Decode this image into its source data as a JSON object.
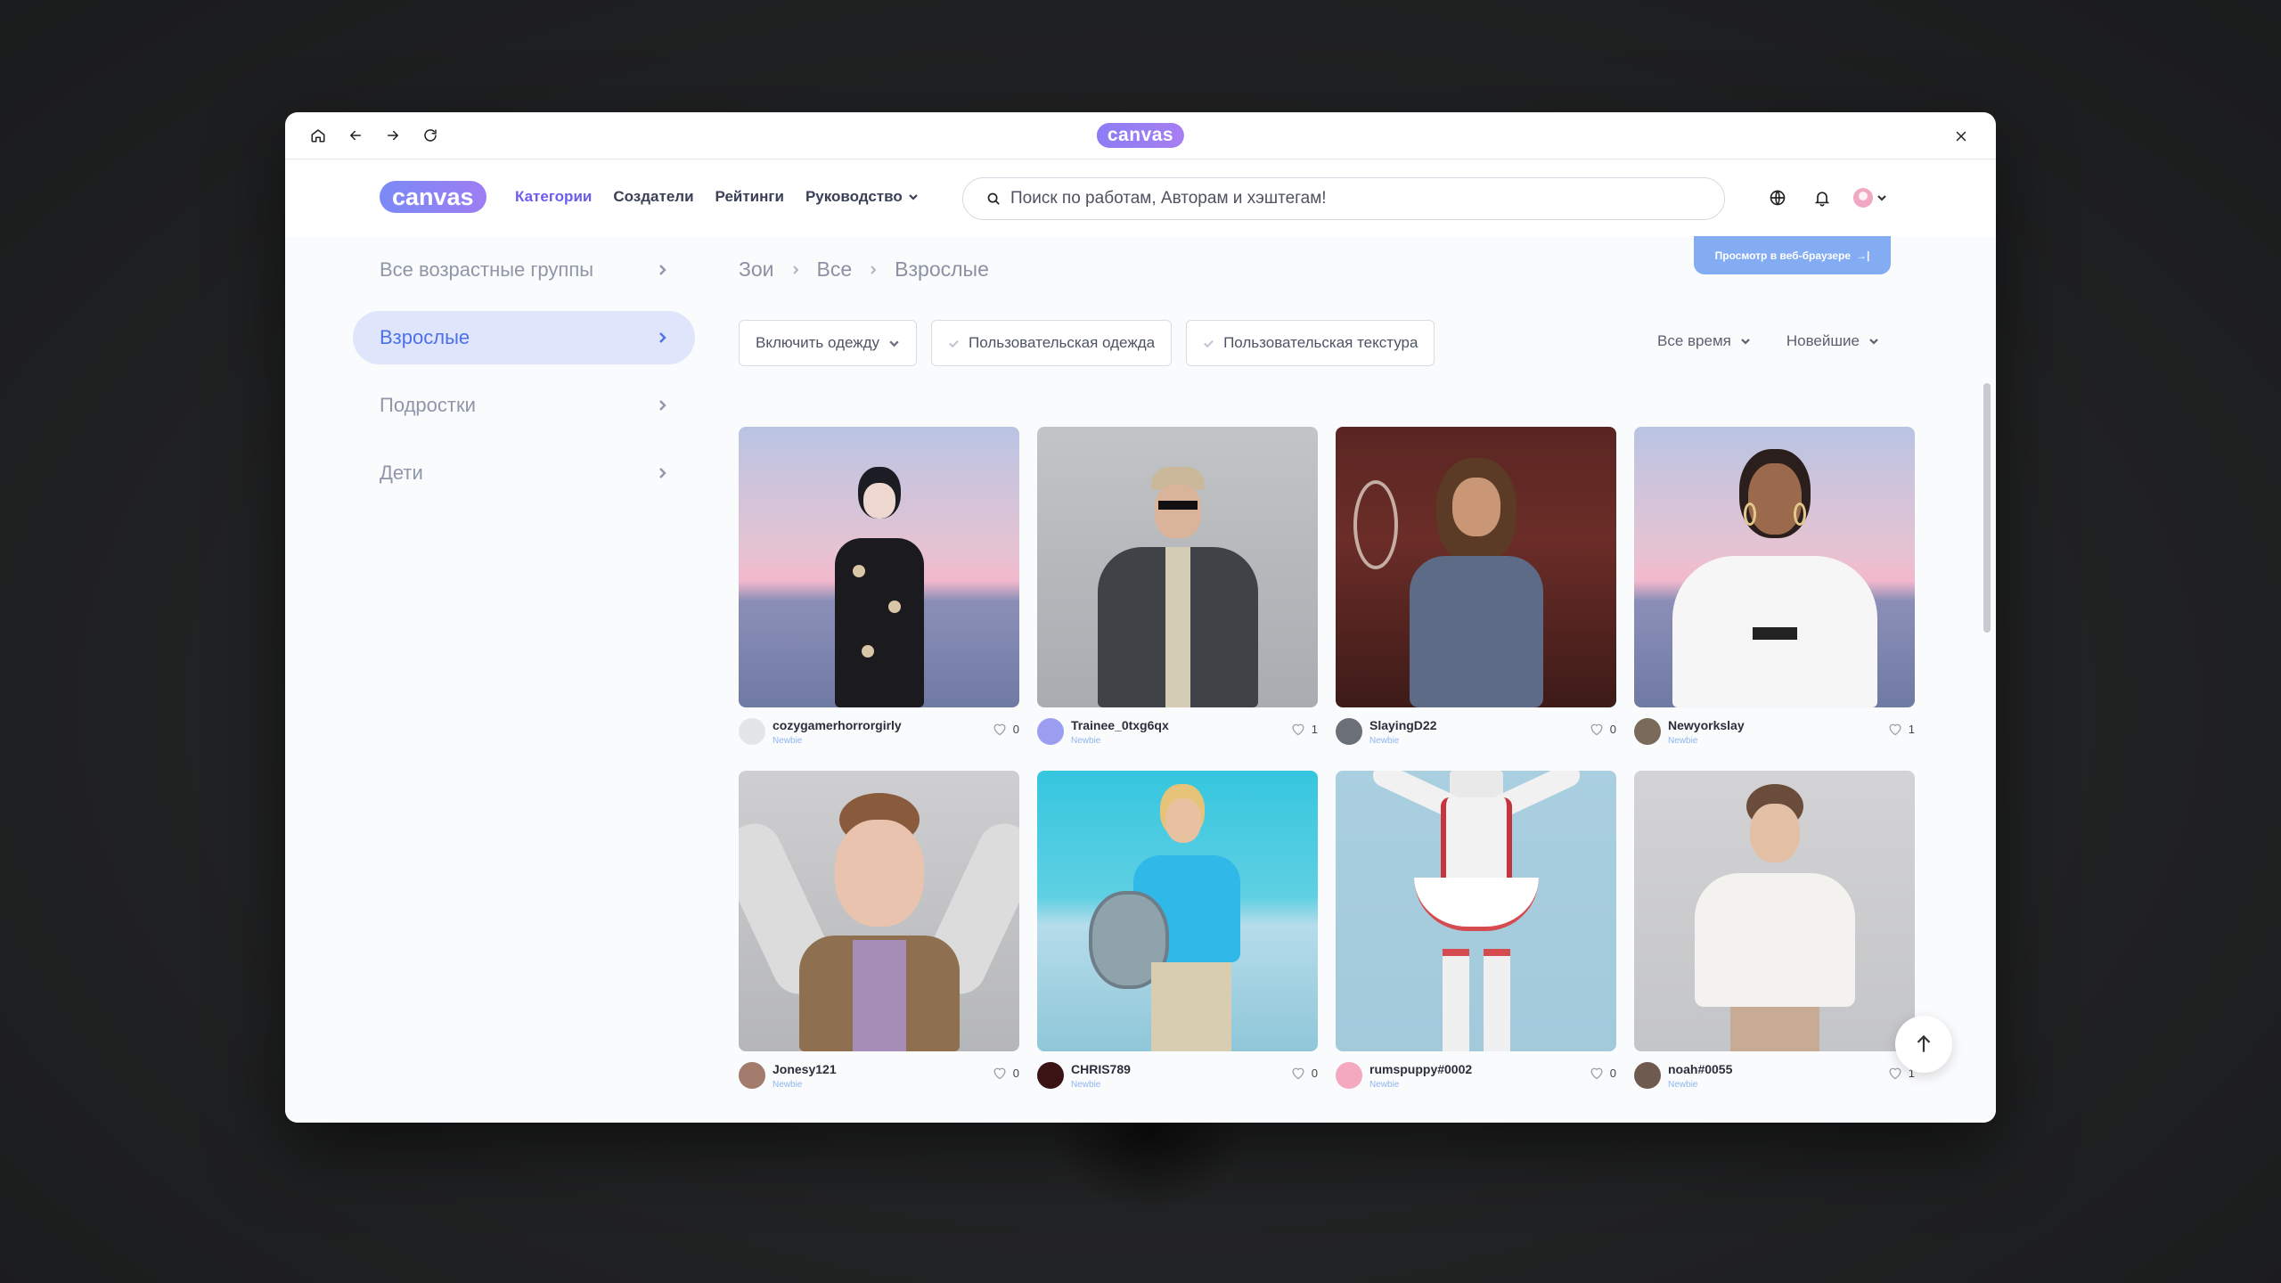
{
  "browser": {
    "logo_text": "canvas"
  },
  "header": {
    "logo_text": "canvas",
    "nav": [
      {
        "label": "Категории",
        "active": true
      },
      {
        "label": "Создатели"
      },
      {
        "label": "Рейтинги"
      },
      {
        "label": "Руководство",
        "dropdown": true
      }
    ],
    "search_placeholder": "Поиск по работам, Авторам и хэштегам!"
  },
  "sidebar": {
    "items": [
      {
        "label": "Все возрастные группы"
      },
      {
        "label": "Взрослые",
        "active": true
      },
      {
        "label": "Подростки"
      },
      {
        "label": "Дети"
      }
    ]
  },
  "breadcrumb": [
    "Зои",
    "Все",
    "Взрослые"
  ],
  "web_button": "Просмотр в веб-браузере",
  "filters": {
    "include_clothing": "Включить одежду",
    "custom_clothing": "Пользовательская одежда",
    "custom_texture": "Пользовательская текстура"
  },
  "sort": {
    "time": "Все время",
    "order": "Новейшие"
  },
  "cards": [
    {
      "author": "cozygamerhorrorgirly",
      "badge": "Newbie",
      "likes": "0"
    },
    {
      "author": "Trainee_0txg6qx",
      "badge": "Newbie",
      "likes": "1"
    },
    {
      "author": "SlayingD22",
      "badge": "Newbie",
      "likes": "0"
    },
    {
      "author": "Newyorkslay",
      "badge": "Newbie",
      "likes": "1"
    },
    {
      "author": "Jonesy121",
      "badge": "Newbie",
      "likes": "0"
    },
    {
      "author": "CHRIS789",
      "badge": "Newbie",
      "likes": "0"
    },
    {
      "author": "rumspuppy#0002",
      "badge": "Newbie",
      "likes": "0"
    },
    {
      "author": "noah#0055",
      "badge": "Newbie",
      "likes": "1"
    }
  ],
  "colors": {
    "accent": "#6a5df0",
    "sidebar_active_bg": "#dfe6fb",
    "sidebar_active_text": "#4d6fe8",
    "badge": "#8fb4ef",
    "web_button": "#83acf3"
  }
}
